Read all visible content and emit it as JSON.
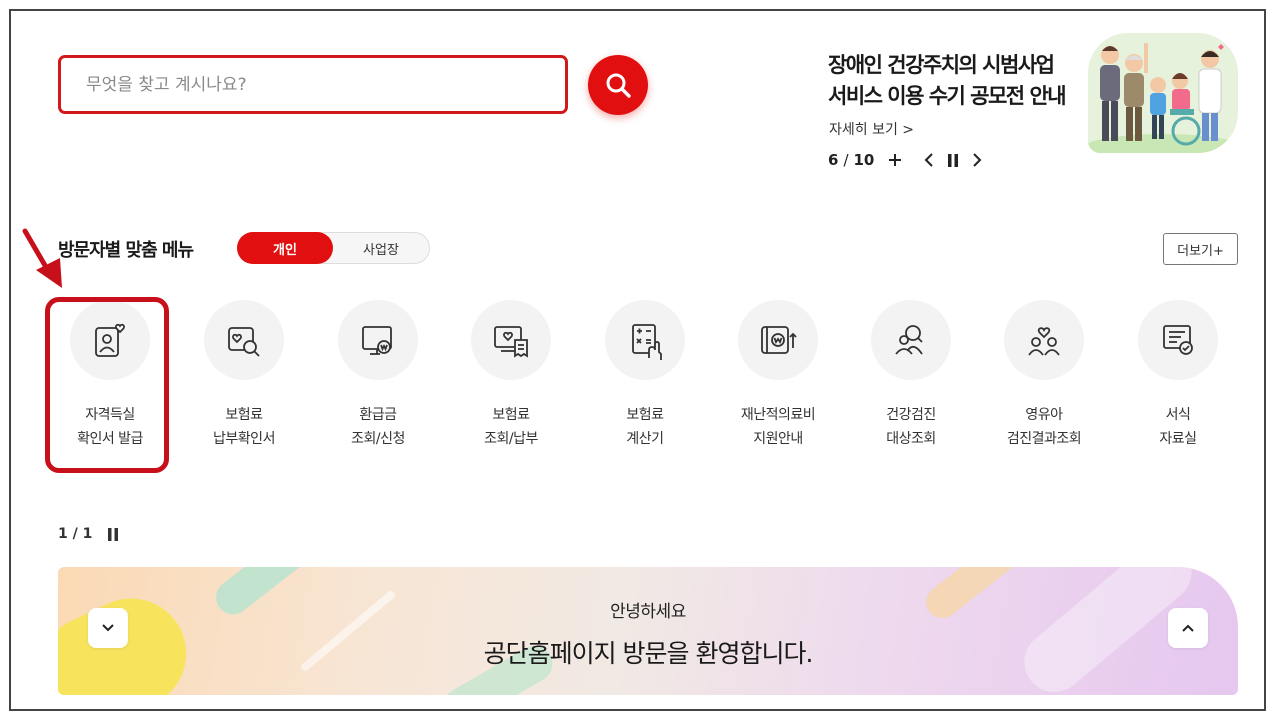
{
  "search": {
    "placeholder": "무엇을 찾고 계시나요?",
    "button_icon": "search-icon"
  },
  "banner": {
    "title_line1": "장애인 건강주치의 시범사업",
    "title_line2": "서비스 이용 수기 공모전 안내",
    "more_label": "자세히 보기 >",
    "current": "6",
    "separator": "/",
    "total": "10"
  },
  "menu": {
    "title": "방문자별 맞춤 메뉴",
    "tabs": [
      {
        "label": "개인",
        "active": true
      },
      {
        "label": "사업장",
        "active": false
      }
    ],
    "more_label": "더보기+",
    "items": [
      {
        "line1": "자격득실",
        "line2": "확인서 발급",
        "icon": "id-card-heart-icon"
      },
      {
        "line1": "보험료",
        "line2": "납부확인서",
        "icon": "document-search-icon"
      },
      {
        "line1": "환급금",
        "line2": "조회/신청",
        "icon": "monitor-won-icon"
      },
      {
        "line1": "보험료",
        "line2": "조회/납부",
        "icon": "computer-receipt-icon"
      },
      {
        "line1": "보험료",
        "line2": "계산기",
        "icon": "calculator-icon"
      },
      {
        "line1": "재난적의료비",
        "line2": "지원안내",
        "icon": "won-support-icon"
      },
      {
        "line1": "건강검진",
        "line2": "대상조회",
        "icon": "people-search-icon"
      },
      {
        "line1": "영유아",
        "line2": "검진결과조회",
        "icon": "family-heart-icon"
      },
      {
        "line1": "서식",
        "line2": "자료실",
        "icon": "form-document-icon"
      }
    ]
  },
  "pager": {
    "text": "1 / 1"
  },
  "welcome": {
    "greeting": "안녕하세요",
    "message": "공단홈페이지 방문을 환영합니다."
  },
  "colors": {
    "accent": "#e10f0f",
    "highlight": "#c8101a"
  }
}
